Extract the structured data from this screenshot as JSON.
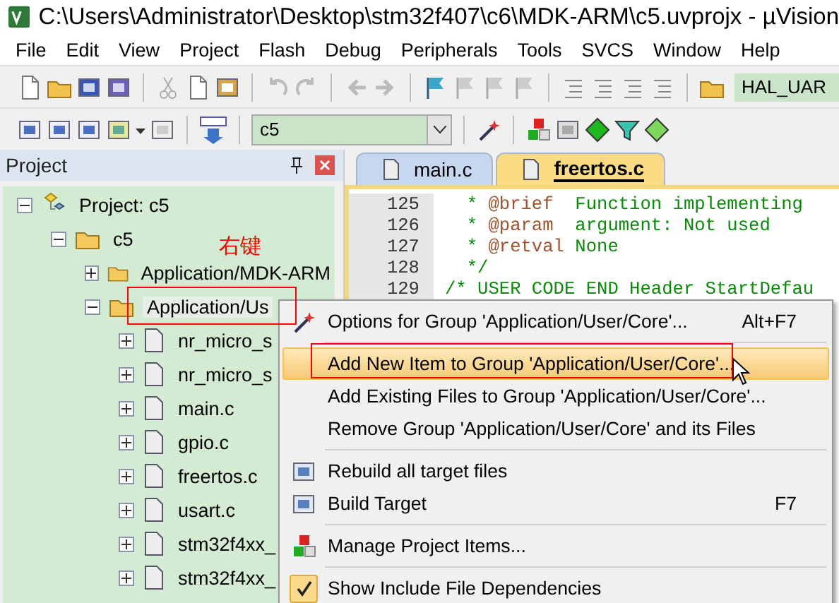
{
  "window": {
    "title": "C:\\Users\\Administrator\\Desktop\\stm32f407\\c6\\MDK-ARM\\c5.uvprojx - µVision"
  },
  "menu_bar": [
    "File",
    "Edit",
    "View",
    "Project",
    "Flash",
    "Debug",
    "Peripherals",
    "Tools",
    "SVCS",
    "Window",
    "Help"
  ],
  "toolbar": {
    "find_field": {
      "value": "HAL_UAR"
    }
  },
  "build_toolbar": {
    "target_select": {
      "value": "c5"
    }
  },
  "project_panel": {
    "title": "Project",
    "tree": [
      {
        "label": "Project: c5",
        "kind": "project",
        "expanded": true,
        "selected": false,
        "children": [
          {
            "label": "c5",
            "kind": "target",
            "expanded": true,
            "selected": false,
            "children": [
              {
                "label": "Application/MDK-ARM",
                "kind": "group",
                "expanded": false,
                "selected": false
              },
              {
                "label": "Application/Us",
                "kind": "group",
                "expanded": true,
                "selected": true,
                "children": [
                  {
                    "label": "nr_micro_s",
                    "kind": "file",
                    "expanded": false,
                    "selected": false
                  },
                  {
                    "label": "nr_micro_s",
                    "kind": "file",
                    "expanded": false,
                    "selected": false
                  },
                  {
                    "label": "main.c",
                    "kind": "file",
                    "expanded": false,
                    "selected": false
                  },
                  {
                    "label": "gpio.c",
                    "kind": "file",
                    "expanded": false,
                    "selected": false
                  },
                  {
                    "label": "freertos.c",
                    "kind": "file",
                    "expanded": false,
                    "selected": false
                  },
                  {
                    "label": "usart.c",
                    "kind": "file",
                    "expanded": false,
                    "selected": false
                  },
                  {
                    "label": "stm32f4xx_",
                    "kind": "file",
                    "expanded": false,
                    "selected": false
                  },
                  {
                    "label": "stm32f4xx_",
                    "kind": "file",
                    "expanded": false,
                    "selected": false
                  }
                ]
              }
            ]
          }
        ]
      }
    ]
  },
  "editor": {
    "tabs": [
      {
        "label": "main.c",
        "selected": false
      },
      {
        "label": "freertos.c",
        "selected": true
      }
    ],
    "lines": [
      {
        "number": "125",
        "parts": [
          {
            "kind": "comment",
            "text": "  * "
          },
          {
            "kind": "tag",
            "text": "@brief"
          },
          {
            "kind": "comment",
            "text": "  Function implementing"
          }
        ]
      },
      {
        "number": "126",
        "parts": [
          {
            "kind": "comment",
            "text": "  * "
          },
          {
            "kind": "tag",
            "text": "@param"
          },
          {
            "kind": "comment",
            "text": "  argument: Not used"
          }
        ]
      },
      {
        "number": "127",
        "parts": [
          {
            "kind": "comment",
            "text": "  * "
          },
          {
            "kind": "tag",
            "text": "@retval"
          },
          {
            "kind": "comment",
            "text": " None"
          }
        ]
      },
      {
        "number": "128",
        "parts": [
          {
            "kind": "comment",
            "text": "  */"
          }
        ]
      },
      {
        "number": "129",
        "parts": [
          {
            "kind": "comment",
            "text": "/* USER CODE END Header StartDefau"
          }
        ]
      }
    ]
  },
  "context_menu": {
    "items": [
      {
        "kind": "item",
        "label": "Options for Group 'Application/User/Core'...",
        "shortcut": "Alt+F7",
        "selected": false,
        "checked": false
      },
      {
        "kind": "separator"
      },
      {
        "kind": "item",
        "label": "Add New  Item to Group 'Application/User/Core'...",
        "selected": true,
        "checked": false
      },
      {
        "kind": "item",
        "label": "Add Existing Files to Group 'Application/User/Core'...",
        "selected": false,
        "checked": false
      },
      {
        "kind": "item",
        "label": "Remove Group 'Application/User/Core' and its Files",
        "selected": false,
        "checked": false
      },
      {
        "kind": "separator"
      },
      {
        "kind": "item",
        "label": "Rebuild all target files",
        "selected": false,
        "checked": false
      },
      {
        "kind": "item",
        "label": "Build Target",
        "shortcut": "F7",
        "selected": false,
        "checked": false
      },
      {
        "kind": "separator"
      },
      {
        "kind": "item",
        "label": "Manage Project Items...",
        "selected": false,
        "checked": false
      },
      {
        "kind": "separator"
      },
      {
        "kind": "item",
        "label": "Show Include File Dependencies",
        "selected": false,
        "checked": true
      }
    ]
  },
  "annotation": {
    "label": "右键"
  }
}
